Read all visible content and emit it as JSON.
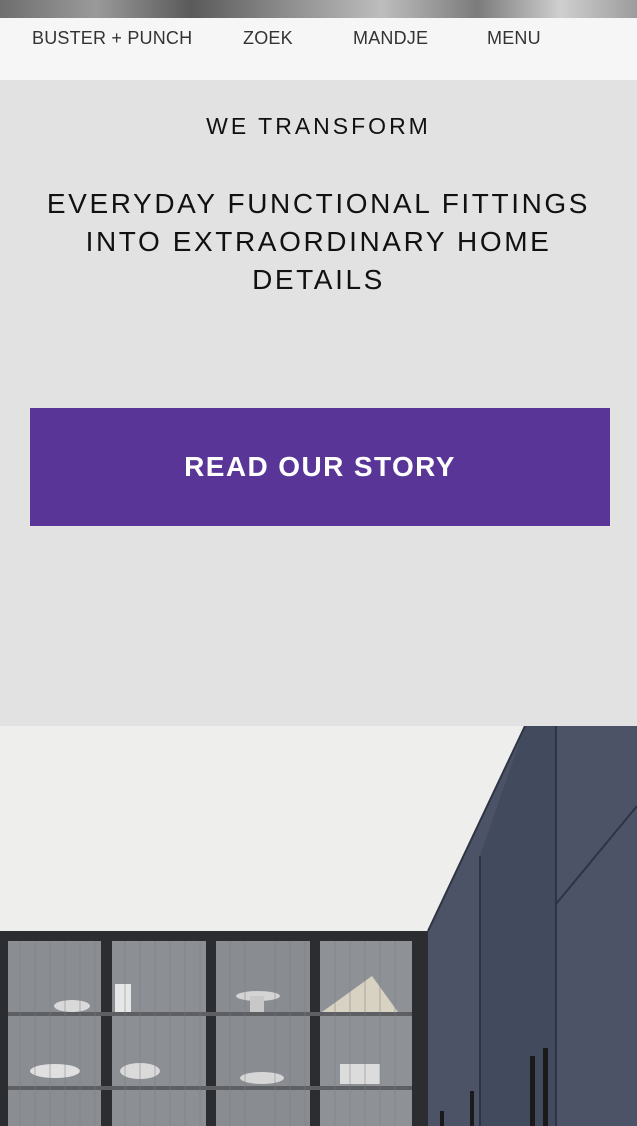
{
  "nav": {
    "brand": "BUSTER + PUNCH",
    "search": "ZOEK",
    "cart": "MANDJE",
    "menu": "MENU"
  },
  "hero": {
    "kicker": "WE TRANSFORM",
    "headline": "EVERYDAY FUNCTIONAL FITTINGS INTO EXTRAORDINARY HOME DETAILS",
    "cta_label": "READ OUR STORY",
    "cta_color": "#583597",
    "background": "#e2e2e2"
  },
  "photo": {
    "subject": "kitchen-cabinet-photo"
  }
}
